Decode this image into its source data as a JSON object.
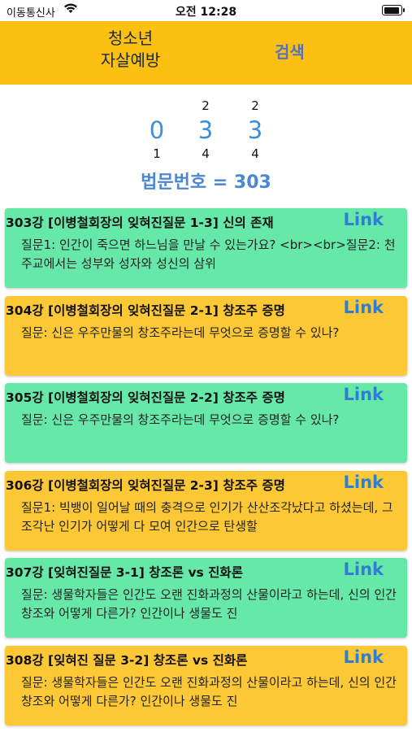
{
  "status_bar": {
    "carrier": "이동통신사",
    "time": "오전 12:28"
  },
  "header": {
    "title": "청소년\n자살예방",
    "search_label": "검색"
  },
  "pickers": [
    {
      "above": "",
      "value": "0",
      "below": "1"
    },
    {
      "above": "2",
      "value": "3",
      "below": "4"
    },
    {
      "above": "2",
      "value": "3",
      "below": "4"
    }
  ],
  "law_number_text": "법문번호 = 303",
  "lectures": [
    {
      "title": "303강 [이병철회장의 잊혀진질문 1-3] 신의 존재",
      "link_label": "Link",
      "body": "질문1: 인간이 죽으면 하느님을 만날 수 있는가요? <br><br>질문2: 천주교에서는 성부와 성자와 성신의 삼위",
      "color": "green"
    },
    {
      "title": "304강 [이병철회장의 잊혀진질문 2-1] 창조주 증명",
      "link_label": "Link",
      "body": "질문: 신은 우주만물의 창조주라는데 무엇으로 증명할 수 있나?",
      "color": "yellow"
    },
    {
      "title": "305강 [이병철회장의 잊혀진질문 2-2] 창조주 증명",
      "link_label": "Link",
      "body": "질문: 신은 우주만물의 창조주라는데 무엇으로 증명할 수 있나?",
      "color": "green"
    },
    {
      "title": "306강 [이병철회장의 잊혀진질문 2-3] 창조주 증명",
      "link_label": "Link",
      "body": "질문1: 빅뱅이 일어날 때의 충격으로 인기가 산산조각났다고 하셨는데, 그 조각난 인기가 어떻게 다 모여 인간으로 탄생할",
      "color": "yellow"
    },
    {
      "title": "307강 [잊혀진질문 3-1] 창조론 vs 진화론",
      "link_label": "Link",
      "body": "질문: 생물학자들은 인간도 오랜 진화과정의 산물이라고 하는데, 신의 인간창조와 어떻게 다른가? 인간이나 생물도 진",
      "color": "green"
    },
    {
      "title": "308강 [잊혀진 질문 3-2] 창조론 vs 진화론",
      "link_label": "Link",
      "body": "질문: 생물학자들은 인간도 오랜 진화과정의 산물이라고 하는데, 신의 인간창조와 어떻게 다른가? 인간이나 생물도 진",
      "color": "yellow"
    }
  ]
}
